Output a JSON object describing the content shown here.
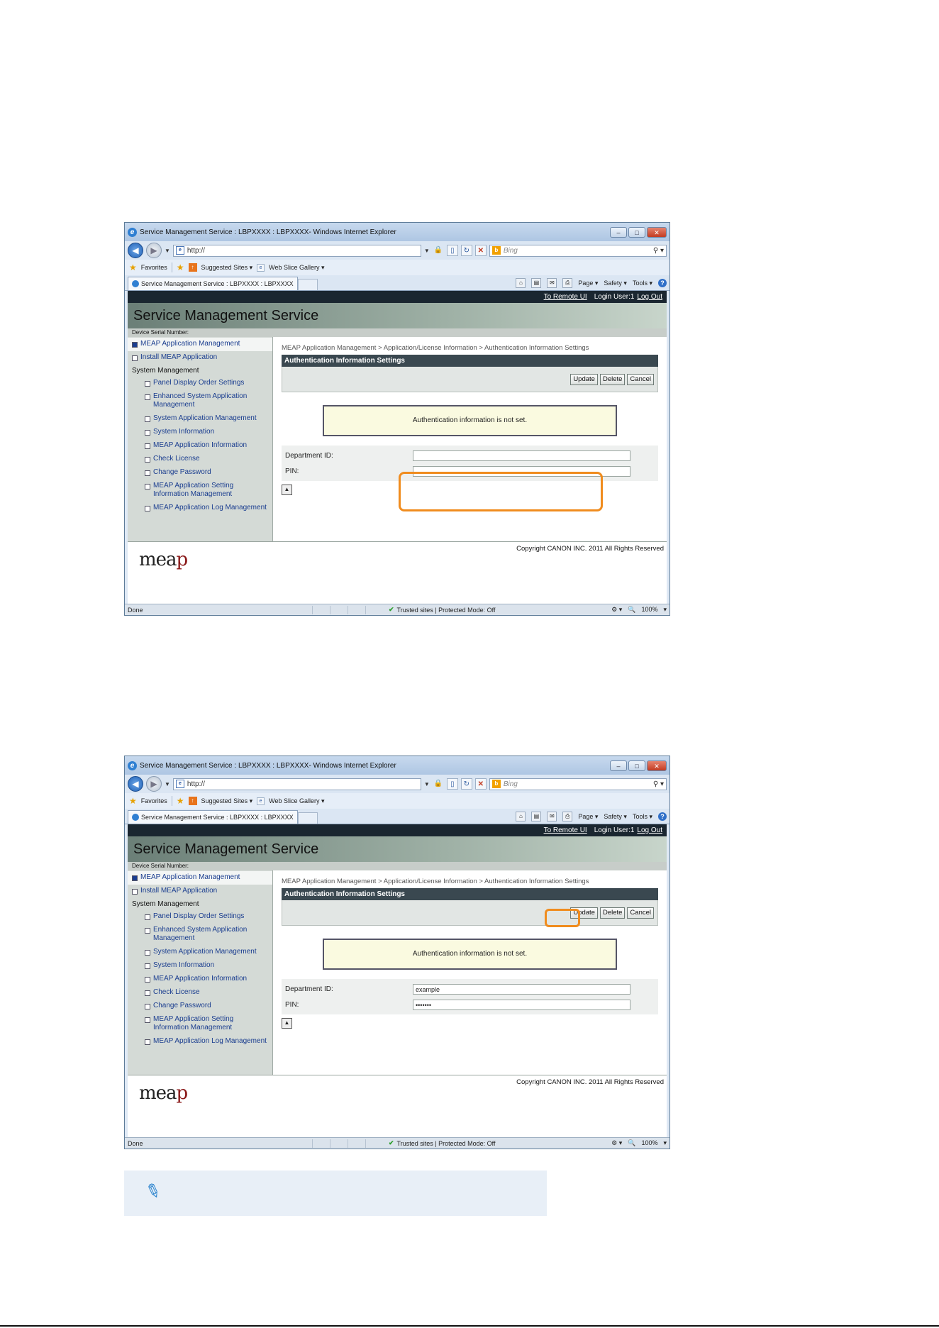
{
  "window": {
    "title": "Service Management Service : LBPXXXX : LBPXXXX- Windows Internet Explorer",
    "address": "http://",
    "search_placeholder": "Bing",
    "favorites_label": "Favorites",
    "suggested_sites": "Suggested Sites ▾",
    "web_slice": "Web Slice Gallery ▾",
    "tab_title": "Service Management Service : LBPXXXX : LBPXXXX",
    "cmd_page": "Page ▾",
    "cmd_safety": "Safety ▾",
    "cmd_tools": "Tools ▾",
    "status_done": "Done",
    "status_trusted": "Trusted sites | Protected Mode: Off",
    "status_zoom": "100%"
  },
  "app": {
    "link_remote": "To Remote UI",
    "login_user": "Login User:1",
    "link_logout": "Log Out",
    "title": "Service Management Service",
    "serial_label": "Device Serial Number:",
    "copyright": "Copyright CANON INC. 2011 All Rights Reserved",
    "logo_text": "mea",
    "logo_p": "p"
  },
  "sidebar": {
    "items": [
      "MEAP Application Management",
      "Install MEAP Application"
    ],
    "heading": "System Management",
    "subitems": [
      "Panel Display Order Settings",
      "Enhanced System Application Management",
      "System Application Management",
      "System Information",
      "MEAP Application Information",
      "Check License",
      "Change Password",
      "MEAP Application Setting Information Management",
      "MEAP Application Log Management"
    ]
  },
  "main": {
    "breadcrumb": "MEAP Application Management > Application/License Information > Authentication Information Settings",
    "panel_title": "Authentication Information Settings",
    "btn_update": "Update",
    "btn_delete": "Delete",
    "btn_cancel": "Cancel",
    "message": "Authentication information is not set.",
    "dept_label": "Department ID:",
    "pin_label": "PIN:"
  },
  "screens": [
    {
      "dept_value": "",
      "pin_value": ""
    },
    {
      "dept_value": "example",
      "pin_value": "•••••••"
    }
  ],
  "colors": {
    "highlight": "#f08c1e",
    "link_bar": "#1a2630",
    "panel_header": "#3a4850"
  }
}
